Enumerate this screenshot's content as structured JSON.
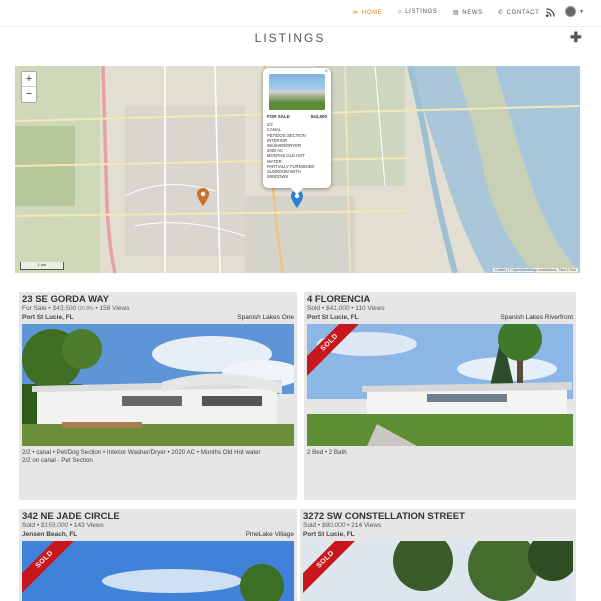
{
  "nav": {
    "home": "HOME",
    "listings": "LISTINGS",
    "news": "NEWS",
    "contact": "CONTACT"
  },
  "page": {
    "title": "LISTINGS"
  },
  "map": {
    "zoom_in": "+",
    "zoom_out": "−",
    "popup": {
      "status": "FOR SALE",
      "price": "$43,500",
      "lines": [
        "2/2",
        "CANAL",
        "PET/DOG SECTION",
        "INTERIOR",
        "WASHER/DRYER",
        "2020 AC",
        "MONTHS OLD HOT",
        "WATER",
        "PARTIALLY FURNISHED",
        "SUNROOM WITH",
        "WINDOWS"
      ]
    },
    "scale": "1 km",
    "attribution": "Leaflet | © OpenStreetMap contributors, Tiles © Esri"
  },
  "listings": [
    {
      "title": "23 SE GORDA WAY",
      "status": "For Sale",
      "price": "$43,500",
      "pct": "(20.8%",
      "views": "158 Views",
      "city": "Port St Lucie, FL",
      "community": "Spanish Lakes One",
      "features": "2/2 • canal • Pet/Dog Section • Interior Washer/Dryer • 2020 AC • Months Old Hot water",
      "features2": "2/2 on canal - Pet Section",
      "sold": ""
    },
    {
      "title": "4 FLORENCIA",
      "status": "Sold",
      "price": "$41,000",
      "pct": "",
      "views": "110 Views",
      "city": "Port St Lucie, FL",
      "community": "Spanish Lakes Riverfront",
      "features": "2 Bed • 2 Bath",
      "features2": "",
      "sold": "SOLD"
    },
    {
      "title": "342 NE JADE CIRCLE",
      "status": "Sold",
      "price": "$159,000",
      "pct": "",
      "views": "143 Views",
      "city": "Jensen Beach, FL",
      "community": "PineLake Village",
      "features": "",
      "features2": "",
      "sold": "SOLD"
    },
    {
      "title": "3272 SW CONSTELLATION STREET",
      "status": "Sold",
      "price": "$80,000",
      "pct": "",
      "views": "214 Views",
      "city": "Port St Lucie, FL",
      "community": "",
      "features": "",
      "features2": "",
      "sold": "SOLD"
    }
  ],
  "colors": {
    "accent": "#e08a2e",
    "sold_ribbon": "#c8161d",
    "card_bg": "#e6e6e6",
    "map_pin_blue": "#2b7fd6",
    "map_pin_orange": "#c9702a"
  }
}
